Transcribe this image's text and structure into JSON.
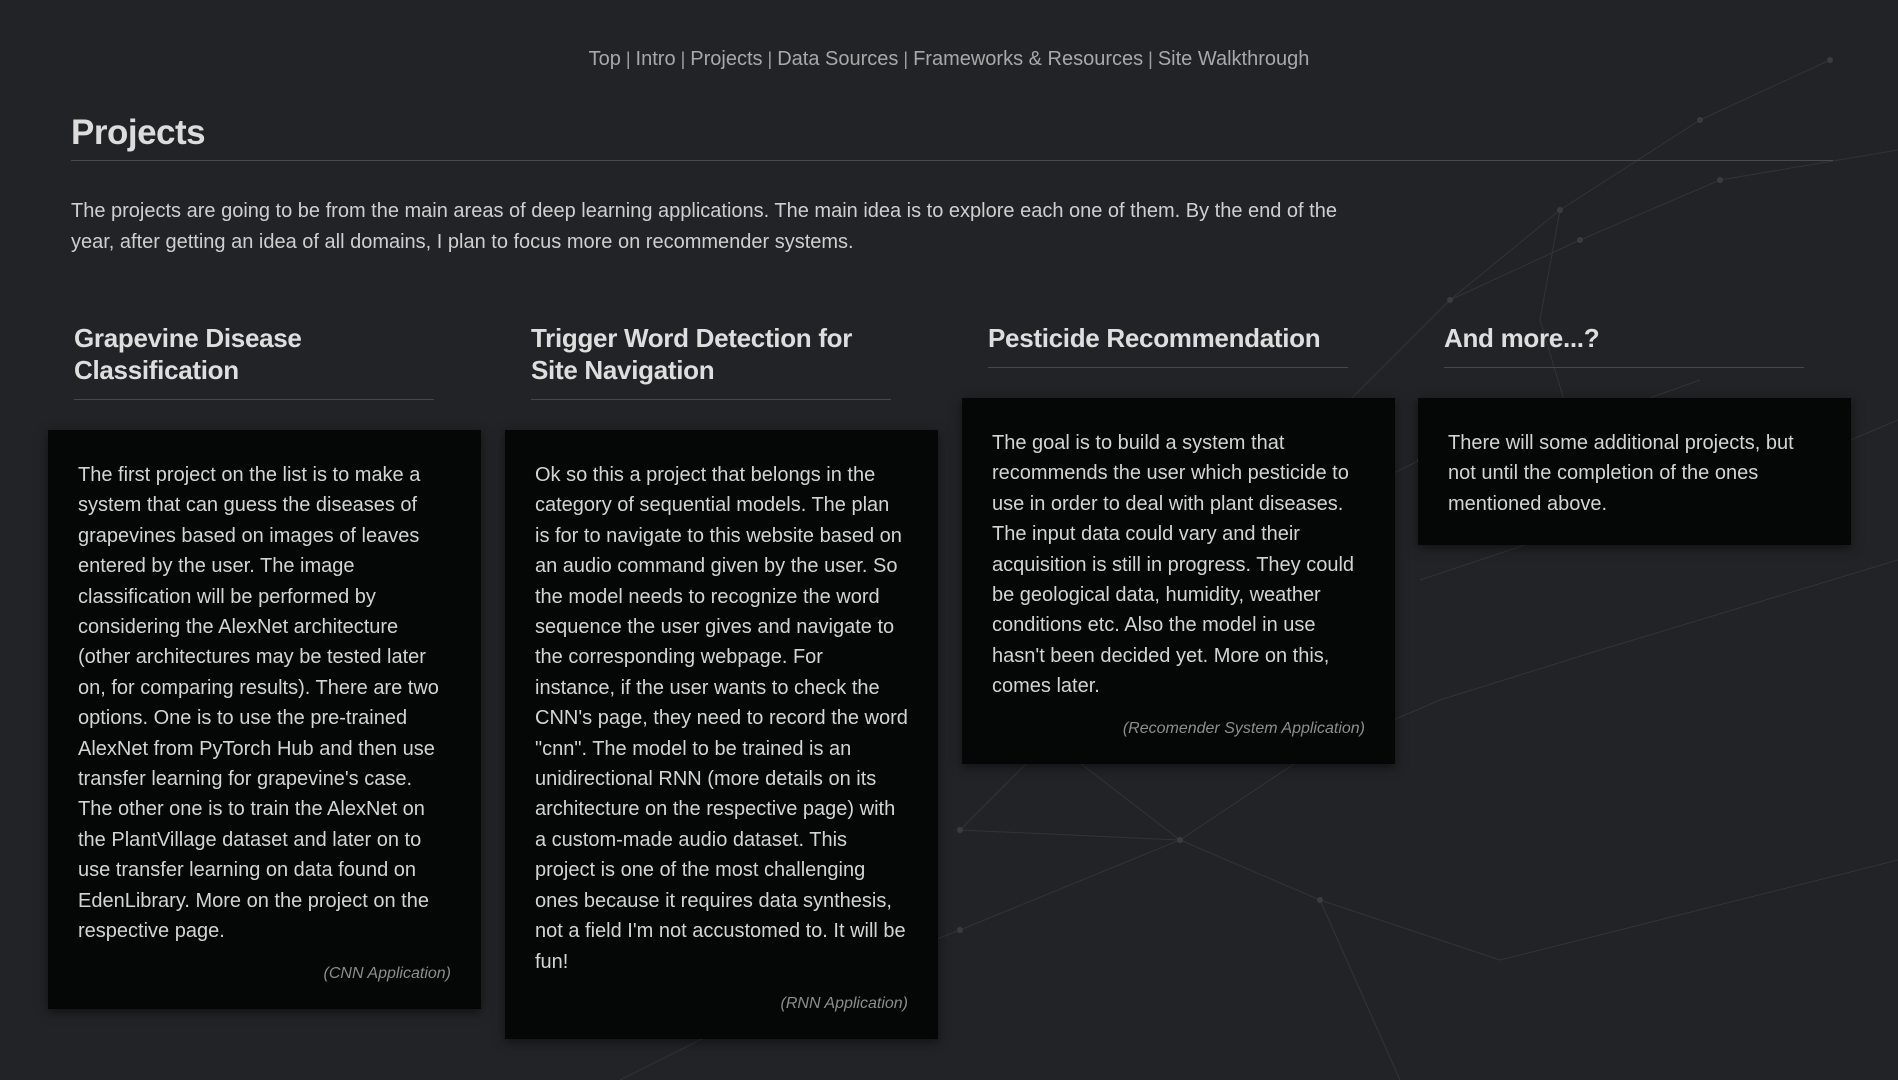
{
  "nav": {
    "items": [
      "Top",
      "Intro",
      "Projects",
      "Data Sources",
      "Frameworks & Resources",
      "Site Walkthrough"
    ],
    "separator": "|"
  },
  "section": {
    "title": "Projects",
    "intro": "The projects are going to be from the main areas of deep learning applications. The main idea is to explore each one of them. By the end of the year, after getting an idea of all domains, I plan to focus more on recommender systems."
  },
  "projects": [
    {
      "title": "Grapevine Disease Classification",
      "description": "The first project on the list is to make a system that can guess the diseases of grapevines based on images of leaves entered by the user. The image classification will be performed by considering the AlexNet architecture (other architectures may be tested later on, for comparing results). There are two options. One is to use the pre-trained AlexNet from PyTorch Hub and then use transfer learning for grapevine's case. The other one is to train the AlexNet on the PlantVillage dataset and later on to use transfer learning on data found on EdenLibrary. More on the project on the respective page.",
      "tag": "(CNN Application)"
    },
    {
      "title": "Trigger Word Detection for Site Navigation",
      "description": "Ok so this a project that belongs in the category of sequential models. The plan is for to navigate to this website based on an audio command given by the user. So the model needs to recognize the word sequence the user gives and navigate to the corresponding webpage. For instance, if the user wants to check the CNN's page, they need to record the word \"cnn\". The model to be trained is an unidirectional RNN (more details on its architecture on the respective page) with a custom-made audio dataset. This project is one of the most challenging ones because it requires data synthesis, not a field I'm not accustomed to. It will be fun!",
      "tag": "(RNN Application)"
    },
    {
      "title": "Pesticide Recommendation",
      "description": "The goal is to build a system that recommends the user which pesticide to use in order to deal with plant diseases. The input data could vary and their acquisition is still in progress. They could be geological data, humidity, weather conditions etc. Also the model in use hasn't been decided yet. More on this, comes later.",
      "tag": "(Recomender System Application)"
    },
    {
      "title": "And more...?",
      "description": "There will some additional projects, but not until the completion of the ones mentioned above.",
      "tag": ""
    }
  ],
  "colors": {
    "background": "#222326",
    "card": "#050606",
    "text": "#d4d4d4",
    "nav_link": "#a8a8a8"
  }
}
